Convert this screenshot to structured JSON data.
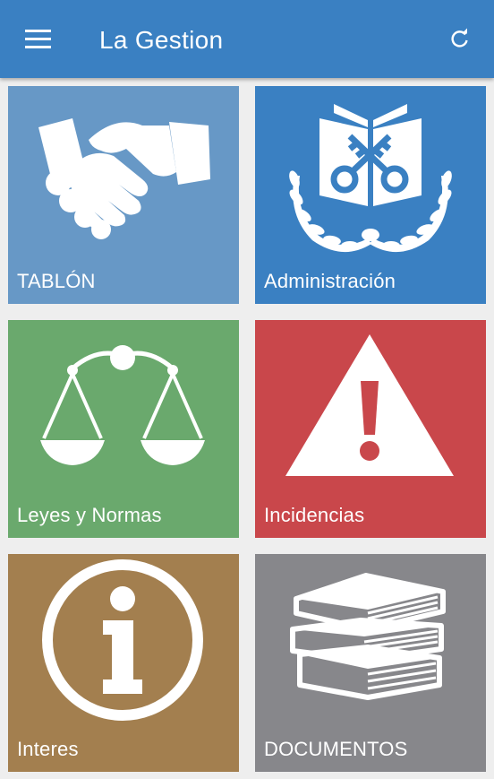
{
  "appbar": {
    "title": "La Gestion",
    "menu_icon": "hamburger-menu-icon",
    "refresh_icon": "refresh-icon",
    "color": "#3a80c2"
  },
  "tiles": [
    {
      "label": "TABLÓN",
      "icon": "handshake-icon",
      "color": "#6798c6"
    },
    {
      "label": "Administración",
      "icon": "keys-book-laurel-icon",
      "color": "#3a80c2"
    },
    {
      "label": "Leyes y Normas",
      "icon": "scales-icon",
      "color": "#6aa96d"
    },
    {
      "label": "Incidencias",
      "icon": "warning-icon",
      "color": "#c9474b"
    },
    {
      "label": "Interes",
      "icon": "info-icon",
      "color": "#a37f4f"
    },
    {
      "label": "DOCUMENTOS",
      "icon": "books-icon",
      "color": "#87878b"
    }
  ]
}
